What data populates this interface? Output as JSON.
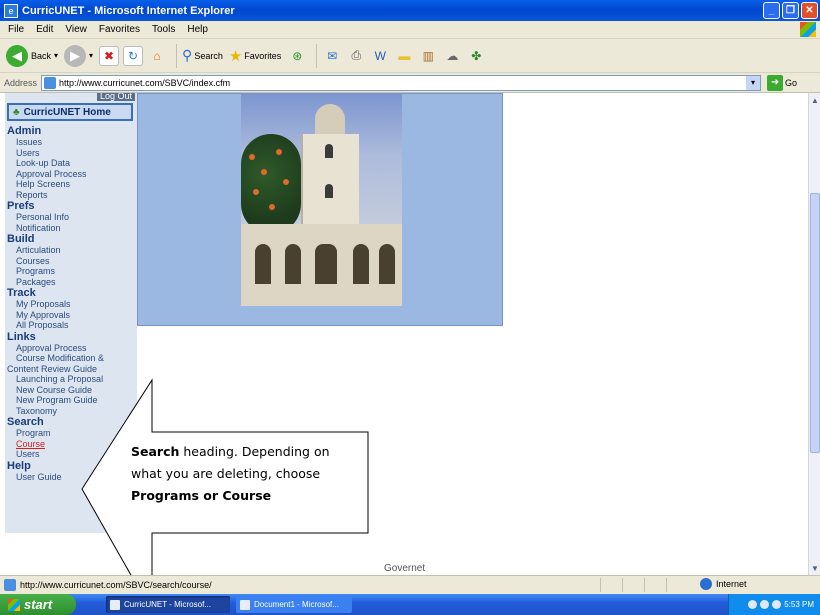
{
  "window": {
    "title": "CurricUNET - Microsoft Internet Explorer"
  },
  "menu": [
    "File",
    "Edit",
    "View",
    "Favorites",
    "Tools",
    "Help"
  ],
  "toolbar": {
    "back": "Back",
    "search": "Search",
    "favorites": "Favorites"
  },
  "address": {
    "label": "Address",
    "url": "http://www.curricunet.com/SBVC/index.cfm",
    "go": "Go"
  },
  "sidebar": {
    "logout": "Log Out",
    "home": "CurricUNET Home",
    "sections": [
      {
        "title": "Admin",
        "items": [
          "Issues",
          "Users",
          "Look-up Data",
          "Approval Process",
          "Help Screens",
          "Reports"
        ]
      },
      {
        "title": "Prefs",
        "items": [
          "Personal Info",
          "Notification"
        ]
      },
      {
        "title": "Build",
        "items": [
          "Articulation",
          "Courses",
          "Programs",
          "Packages"
        ]
      },
      {
        "title": "Track",
        "items": [
          "My Proposals",
          "My Approvals",
          "All Proposals"
        ]
      },
      {
        "title": "Links",
        "items": [
          "Approval Process",
          "Course Modification &",
          "Content Review Guide",
          "Launching a Proposal",
          "New Course Guide",
          "New Program Guide",
          "Taxonomy"
        ]
      },
      {
        "title": "Search",
        "items": [
          "Program",
          "Course",
          "Users"
        ]
      },
      {
        "title": "Help",
        "items": [
          "User Guide"
        ]
      }
    ]
  },
  "main": {
    "footer_text": "Governet"
  },
  "callout": {
    "bold1": "Search",
    "text1": " heading. Depending on what you are deleting, choose ",
    "bold2": "Programs or Course"
  },
  "status": {
    "url": "http://www.curricunet.com/SBVC/search/course/",
    "zone": "Internet"
  },
  "taskbar": {
    "start": "start",
    "task1": "CurricUNET - Microsof...",
    "task2": "Document1 - Microsof...",
    "clock": "5:53 PM"
  }
}
